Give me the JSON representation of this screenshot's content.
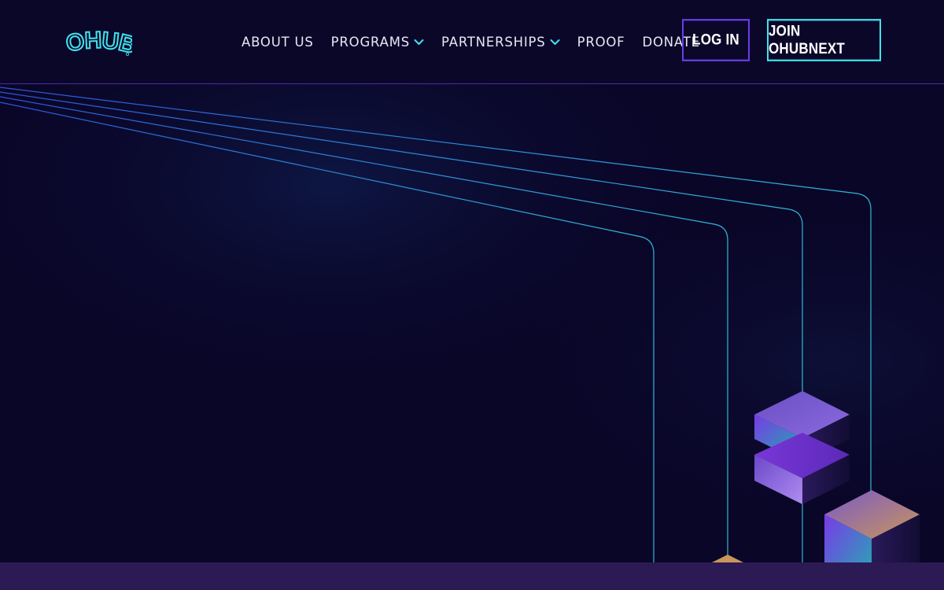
{
  "brand": {
    "logo_text": "OHUB",
    "accent_color": "#3fe3ec",
    "purple_color": "#6a3de8",
    "background_color": "#0a0628"
  },
  "nav": {
    "items": [
      {
        "label": "ABOUT US",
        "has_dropdown": false
      },
      {
        "label": "PROGRAMS",
        "has_dropdown": true
      },
      {
        "label": "PARTNERSHIPS",
        "has_dropdown": true
      },
      {
        "label": "PROOF",
        "has_dropdown": false
      },
      {
        "label": "DONATE",
        "has_dropdown": false
      }
    ]
  },
  "actions": {
    "login_label": "LOG IN",
    "join_label": "JOIN OHUBNEXT"
  }
}
